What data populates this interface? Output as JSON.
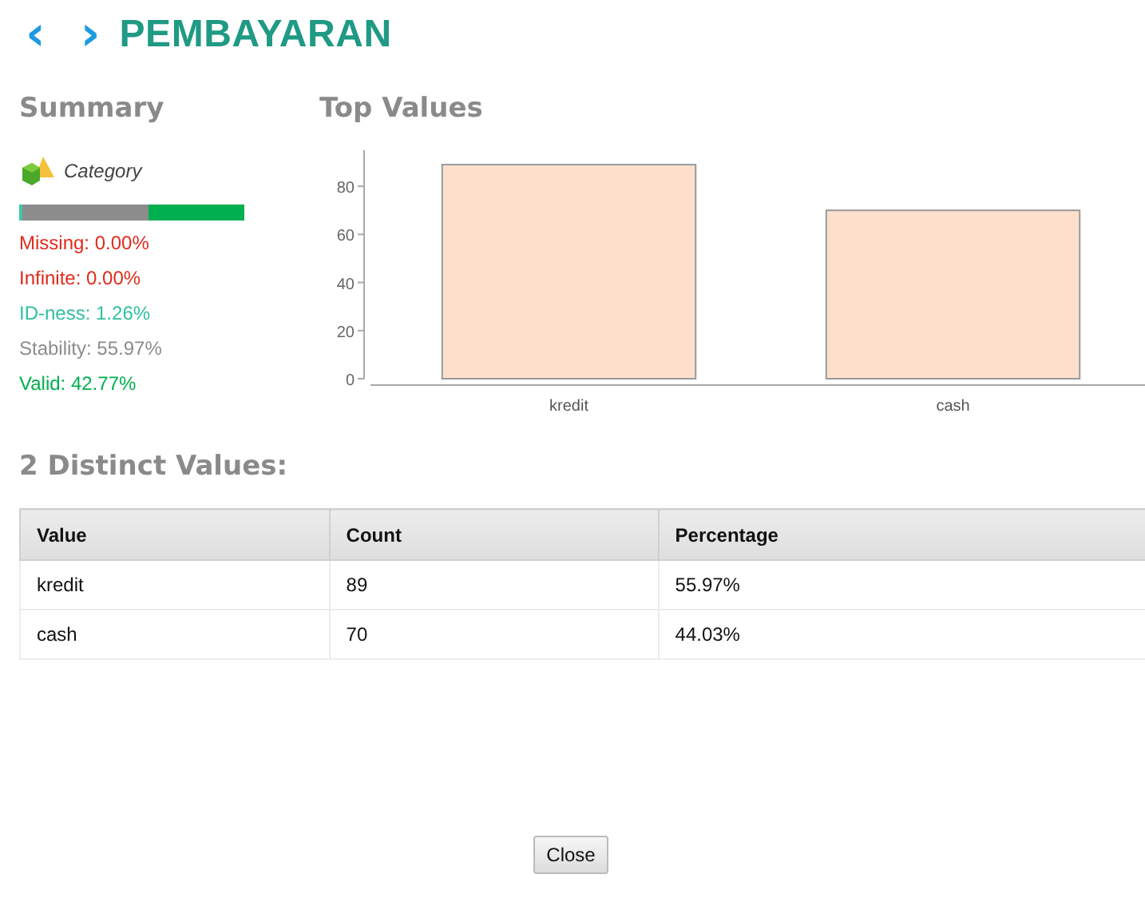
{
  "header": {
    "back": "‹",
    "forward": "›",
    "title": "PEMBAYARAN"
  },
  "summary": {
    "heading": "Summary",
    "type_label": "Category",
    "quality_bar": [
      {
        "level": 0.0126,
        "color": "#3cc7a8"
      },
      {
        "level": 0.5597,
        "color": "#8c8c8c"
      },
      {
        "level": 0.4277,
        "color": "#00b050"
      }
    ],
    "stats": [
      {
        "text": "Missing: 0.00%",
        "color": "#e02a1a"
      },
      {
        "text": "Infinite: 0.00%",
        "color": "#e02a1a"
      },
      {
        "text": "ID-ness: 1.26%",
        "color": "#2fbfa0"
      },
      {
        "text": "Stability: 55.97%",
        "color": "#8c8c8c"
      },
      {
        "text": "Valid: 42.77%",
        "color": "#00b050"
      }
    ]
  },
  "top_values": {
    "heading": "Top Values",
    "chart_data": {
      "type": "bar",
      "categories": [
        "kredit",
        "cash"
      ],
      "values": [
        89,
        70
      ],
      "ylim": [
        0,
        95
      ],
      "yticks": [
        0,
        20,
        40,
        60,
        80
      ]
    }
  },
  "distinct": {
    "heading": "2 Distinct Values:",
    "columns": [
      "Value",
      "Count",
      "Percentage"
    ],
    "rows": [
      [
        "kredit",
        "89",
        "55.97%"
      ],
      [
        "cash",
        "70",
        "44.03%"
      ]
    ]
  },
  "close_button": "Close"
}
